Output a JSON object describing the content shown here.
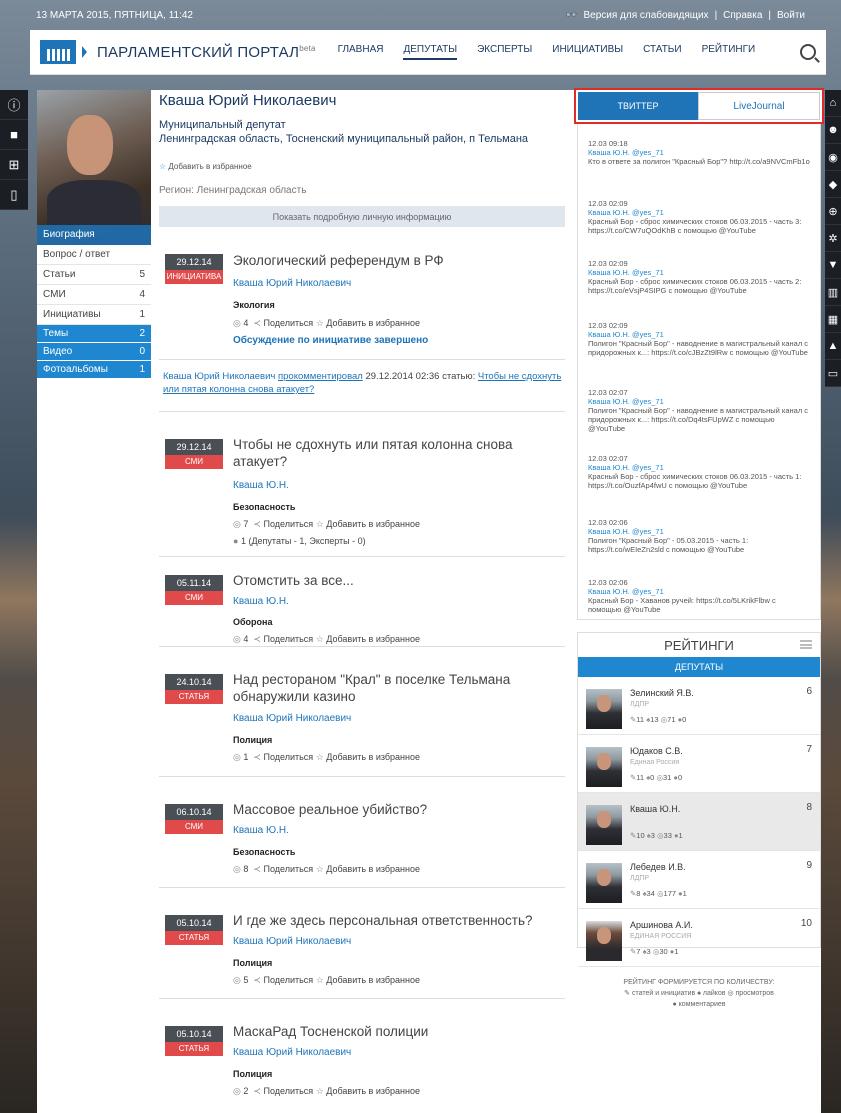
{
  "topbar": {
    "datetime": "13 МАРТА 2015, ПЯТНИЦА, 11:42",
    "accessibility": "Версия для слабовидящих",
    "help": "Справка",
    "login": "Войти"
  },
  "header": {
    "title": "ПАРЛАМЕНТСКИЙ ПОРТАЛ",
    "beta": "beta",
    "nav": [
      "ГЛАВНАЯ",
      "ДЕПУТАТЫ",
      "ЭКСПЕРТЫ",
      "ИНИЦИАТИВЫ",
      "СТАТЬИ",
      "РЕЙТИНГИ"
    ]
  },
  "profile": {
    "name": "Кваша Юрий Николаевич",
    "role": "Муниципальный депутат",
    "location": "Ленинградская область, Тосненский муниципальный район, п Тельмана",
    "fav": "Добавить в избранное",
    "region": "Регион: Ленинградская область",
    "show_info": "Показать подробную личную информацию"
  },
  "leftmenu": {
    "bio": "Биография",
    "items": [
      {
        "label": "Вопрос / ответ",
        "count": ""
      },
      {
        "label": "Статьи",
        "count": "5"
      },
      {
        "label": "СМИ",
        "count": "4"
      },
      {
        "label": "Инициативы",
        "count": "1"
      }
    ],
    "blue": [
      {
        "label": "Темы",
        "count": "2"
      },
      {
        "label": "Видео",
        "count": "0"
      },
      {
        "label": "Фотоальбомы",
        "count": "1"
      }
    ]
  },
  "feed": [
    {
      "date": "29.12.14",
      "type": "ИНИЦИАТИВА",
      "title": "Экологический референдум в РФ",
      "author": "Кваша Юрий Николаевич",
      "tag": "Экология",
      "views": "4",
      "share": "Поделиться",
      "fav": "Добавить в избранное",
      "discussion": "Обсуждение по инициативе завершено"
    },
    {
      "date": "29.12.14",
      "type": "СМИ",
      "title": "Чтобы не сдохнуть или пятая колонна снова атакует?",
      "author": "Кваша Ю.Н.",
      "tag": "Безопасность",
      "views": "7",
      "share": "Поделиться",
      "fav": "Добавить в избранное",
      "comments": "1 (Депутаты - 1, Эксперты - 0)"
    },
    {
      "date": "05.11.14",
      "type": "СМИ",
      "title": "Отомстить за все...",
      "author": "Кваша Ю.Н.",
      "tag": "Оборона",
      "views": "4",
      "share": "Поделиться",
      "fav": "Добавить в избранное"
    },
    {
      "date": "24.10.14",
      "type": "СТАТЬЯ",
      "title": "Над рестораном \"Крал\" в поселке Тельмана обнаружили казино",
      "author": "Кваша Юрий Николаевич",
      "tag": "Полиция",
      "views": "1",
      "share": "Поделиться",
      "fav": "Добавить в избранное"
    },
    {
      "date": "06.10.14",
      "type": "СМИ",
      "title": "Массовое реальное убийство?",
      "author": "Кваша Ю.Н.",
      "tag": "Безопасность",
      "views": "8",
      "share": "Поделиться",
      "fav": "Добавить в избранное"
    },
    {
      "date": "05.10.14",
      "type": "СТАТЬЯ",
      "title": "И где же здесь персональная ответственность?",
      "author": "Кваша Юрий Николаевич",
      "tag": "Полиция",
      "views": "5",
      "share": "Поделиться",
      "fav": "Добавить в избранное"
    },
    {
      "date": "05.10.14",
      "type": "СТАТЬЯ",
      "title": "МаскаРад Тосненской полиции",
      "author": "Кваша Юрий Николаевич",
      "tag": "Полиция",
      "views": "2",
      "share": "Поделиться",
      "fav": "Добавить в избранное"
    }
  ],
  "comment": {
    "author": "Кваша Юрий Николаевич",
    "action": "прокомментировал",
    "when": "29.12.2014 02:36 статью:",
    "link": "Чтобы не сдохнуть или пятая колонна снова атакует?"
  },
  "twitter": {
    "tab1": "ТВИТТЕР",
    "tab2": "LiveJournal",
    "tweets": [
      {
        "time": "12.03 09:18",
        "author": "Кваша Ю.Н. @yes_71",
        "text": "Кто в ответе за полигон \"Красный Бор\"? http://t.co/a9NVCmFb1o"
      },
      {
        "time": "12.03 02:09",
        "author": "Кваша Ю.Н. @yes_71",
        "text": "Красный Бор - сброс химических стоков 06.03.2015 - часть 3: https://t.co/CW7uQOdKhB с помощью @YouTube"
      },
      {
        "time": "12.03 02:09",
        "author": "Кваша Ю.Н. @yes_71",
        "text": "Красный Бор - сброс химических стоков 06.03.2015 - часть 2: https://t.co/eVsjP4SIPG с помощью @YouTube"
      },
      {
        "time": "12.03 02:09",
        "author": "Кваша Ю.Н. @yes_71",
        "text": "Полигон \"Красный Бор\" - наводнение в магистральный канал с придорожных к...: https://t.co/cJBzZt9lRw с помощью @YouTube"
      },
      {
        "time": "12.03 02:07",
        "author": "Кваша Ю.Н. @yes_71",
        "text": "Полигон \"Красный Бор\" - наводнение в магистральный канал с придорожных к...: https://t.co/Dq4tsFUpWZ с помощью @YouTube"
      },
      {
        "time": "12.03 02:07",
        "author": "Кваша Ю.Н. @yes_71",
        "text": "Красный Бор - сброс химических стоков 06.03.2015 - часть 1: https://t.co/OuzfAp4fwU с помощью @YouTube"
      },
      {
        "time": "12.03 02:06",
        "author": "Кваша Ю.Н. @yes_71",
        "text": "Полигон \"Красный Бор\" - 05.03.2015 - часть 1: https://t.co/wEIeZn2sld с помощью @YouTube"
      },
      {
        "time": "12.03 02:06",
        "author": "Кваша Ю.Н. @yes_71",
        "text": "Красный Бор - Хаванов ручей: https://t.co/5LKrikFlbw с помощью @YouTube"
      }
    ]
  },
  "ratings": {
    "title": "РЕЙТИНГИ",
    "tab": "ДЕПУТАТЫ",
    "rows": [
      {
        "name": "Зелинский Я.В.",
        "party": "ЛДПР",
        "rank": "6",
        "s1": "11",
        "s2": "13",
        "s3": "71",
        "s4": "0"
      },
      {
        "name": "Юдаков С.В.",
        "party": "Единая Россия",
        "rank": "7",
        "s1": "11",
        "s2": "0",
        "s3": "31",
        "s4": "0"
      },
      {
        "name": "Кваша Ю.Н.",
        "party": "",
        "rank": "8",
        "s1": "10",
        "s2": "3",
        "s3": "33",
        "s4": "1"
      },
      {
        "name": "Лебедев И.В.",
        "party": "ЛДПР",
        "rank": "9",
        "s1": "8",
        "s2": "34",
        "s3": "177",
        "s4": "1"
      },
      {
        "name": "Аршинова А.И.",
        "party": "ЕДИНАЯ РОССИЯ",
        "rank": "10",
        "s1": "7",
        "s2": "3",
        "s3": "30",
        "s4": "1"
      }
    ],
    "foot1": "РЕЙТИНГ ФОРМИРУЕТСЯ ПО КОЛИЧЕСТВУ:",
    "foot2": "статей и инициатив",
    "foot3": "лайков",
    "foot4": "просмотров",
    "foot5": "комментариев"
  }
}
